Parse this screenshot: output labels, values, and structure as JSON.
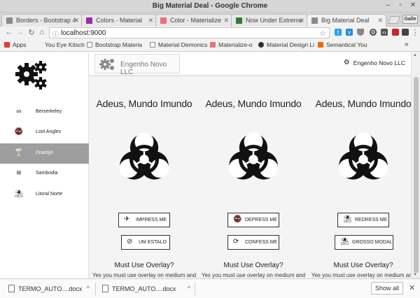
{
  "window": {
    "title": "Big Material Deal - Google Chrome",
    "user_badge": "Galle"
  },
  "tabs": [
    {
      "label": "Borders - Bootstrap 4",
      "color": "#8a8a8a",
      "active": false
    },
    {
      "label": "Colors - Material",
      "color": "#9c27b0",
      "active": false
    },
    {
      "label": "Color - Materialize",
      "color": "#ee6e73",
      "active": false
    },
    {
      "label": "Now Under Extreme",
      "color": "#2e7d32",
      "active": false
    },
    {
      "label": "Big Material Deal",
      "color": "#8a8a8a",
      "active": true
    }
  ],
  "toolbar": {
    "url": "localhost:9000"
  },
  "bookmarks": [
    {
      "label": "Apps",
      "color": "#e53935"
    },
    {
      "label": "You Eye Kitsch",
      "color": "#f2f2f2"
    },
    {
      "label": "Bootstrap Materia",
      "color": "#9e9e9e"
    },
    {
      "label": "Material Demonics",
      "color": "#9e9e9e"
    },
    {
      "label": "Materialize-o",
      "color": "#ee6e73"
    },
    {
      "label": "Material Design Li",
      "color": "#333333"
    },
    {
      "label": "Semantical You",
      "color": "#ef6c00"
    }
  ],
  "bookmarks_more": "»",
  "sidebar": {
    "items": [
      {
        "label": "Berserkeley",
        "icon": "∞"
      },
      {
        "label": "Lost Angles",
        "icon": "🚭"
      },
      {
        "label": "Drazilyn",
        "icon": "🍸"
      },
      {
        "label": "Sambodia",
        "icon": "≋"
      },
      {
        "label": "Litoral Norte",
        "icon": "⛱"
      }
    ],
    "active_index": 2
  },
  "navbar": {
    "brand": "Engenho Novo LLC",
    "user": "Engenho Novo LLC"
  },
  "cards": [
    {
      "heading": "Adeus, Mundo Imundo",
      "btn1": "Impress Me",
      "btn1_icon": "✈",
      "btn2": "Um Estalo",
      "btn2_icon": "⊘",
      "question": "Must Use Overlay?",
      "desc": "Yes you must use overlay on medium and"
    },
    {
      "heading": "Adeus, Mundo Imundo",
      "btn1": "Depress Me",
      "btn1_icon": "🚭",
      "btn2": "Confess Me",
      "btn2_icon": "⟳",
      "question": "Must Use Overlay?",
      "desc": "Yes you must use overlay on medium and"
    },
    {
      "heading": "Adeus, Mundo Imundo",
      "btn1": "Redress Me",
      "btn1_icon": "⛱",
      "btn2": "Grosso Modal",
      "btn2_icon": "⛱",
      "question": "Must Use Overlay?",
      "desc": "Yes you must use overlay on medium and"
    }
  ],
  "downloads": [
    {
      "filename": "TERMO_AUTO....docx"
    },
    {
      "filename": "TERMO_AUTO....docx"
    }
  ],
  "download_bar": {
    "show_all": "Show all",
    "close": "✕"
  }
}
